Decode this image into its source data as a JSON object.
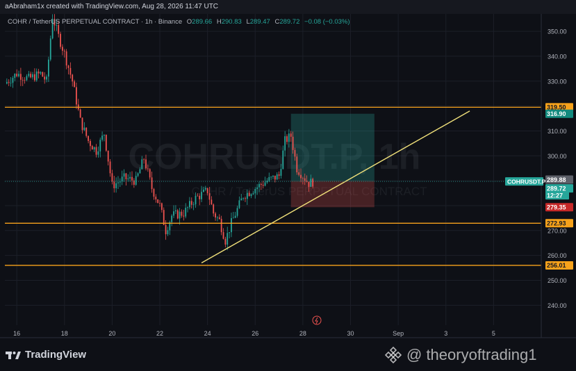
{
  "header": {
    "creator": "aAbraham1x created with TradingView.com, Aug 28, 2026 11:47 UTC",
    "symbol": "COHR / TetherUS PERPETUAL CONTRACT · 1h · Binance",
    "ohlc": [
      {
        "k": "O",
        "v": "289.66"
      },
      {
        "k": "H",
        "v": "290.83"
      },
      {
        "k": "L",
        "v": "289.47"
      },
      {
        "k": "C",
        "v": "289.72"
      }
    ],
    "change": "−0.08 (−0.03%)"
  },
  "watermark": {
    "big": "COHRUSDT.P, 1h",
    "small": "COHR / TetherUS PERPETUAL CONTRACT"
  },
  "footer": {
    "brand": "TradingView",
    "handle": "@ theoryoftrading1"
  },
  "colors": {
    "up": "#26a69a",
    "down": "#ef5350",
    "level": "#f7a21b",
    "trendline": "#f0e07a",
    "background": "#0e1016"
  },
  "chart_data": {
    "type": "candlestick",
    "title": "COHR / TetherUS PERPETUAL CONTRACT · 1h · Binance",
    "yaxis": {
      "ticks": [
        240,
        250,
        260,
        270,
        280,
        290,
        300,
        310,
        320,
        330,
        340,
        350
      ],
      "range": [
        232,
        357
      ]
    },
    "xaxis": {
      "range": [
        "Aug 15 12:00",
        "Sep 7 00:00"
      ],
      "ticks": [
        {
          "date": "Aug 16",
          "label": "16"
        },
        {
          "date": "Aug 18",
          "label": "18"
        },
        {
          "date": "Aug 20",
          "label": "20"
        },
        {
          "date": "Aug 22",
          "label": "22"
        },
        {
          "date": "Aug 24",
          "label": "24"
        },
        {
          "date": "Aug 26",
          "label": "26"
        },
        {
          "date": "Aug 28",
          "label": "28"
        },
        {
          "date": "Aug 30",
          "label": "30"
        },
        {
          "date": "Sep 1",
          "label": "Sep"
        },
        {
          "date": "Sep 3",
          "label": "3"
        },
        {
          "date": "Sep 5",
          "label": "5"
        }
      ]
    },
    "price_path": [
      {
        "t": "Aug 15 12:00",
        "p": 329
      },
      {
        "t": "Aug 16 00:00",
        "p": 333
      },
      {
        "t": "Aug 16 12:00",
        "p": 331
      },
      {
        "t": "Aug 17 00:00",
        "p": 333
      },
      {
        "t": "Aug 17 06:00",
        "p": 330
      },
      {
        "t": "Aug 17 12:00",
        "p": 356
      },
      {
        "t": "Aug 17 18:00",
        "p": 348
      },
      {
        "t": "Aug 18 00:00",
        "p": 341
      },
      {
        "t": "Aug 18 08:00",
        "p": 330
      },
      {
        "t": "Aug 18 16:00",
        "p": 314
      },
      {
        "t": "Aug 19 00:00",
        "p": 306
      },
      {
        "t": "Aug 19 08:00",
        "p": 302
      },
      {
        "t": "Aug 19 16:00",
        "p": 309
      },
      {
        "t": "Aug 20 00:00",
        "p": 288
      },
      {
        "t": "Aug 20 12:00",
        "p": 291
      },
      {
        "t": "Aug 21 00:00",
        "p": 290
      },
      {
        "t": "Aug 21 08:00",
        "p": 299
      },
      {
        "t": "Aug 21 16:00",
        "p": 287
      },
      {
        "t": "Aug 22 00:00",
        "p": 280
      },
      {
        "t": "Aug 22 06:00",
        "p": 270
      },
      {
        "t": "Aug 22 12:00",
        "p": 276
      },
      {
        "t": "Aug 23 00:00",
        "p": 277
      },
      {
        "t": "Aug 23 12:00",
        "p": 283
      },
      {
        "t": "Aug 24 00:00",
        "p": 286
      },
      {
        "t": "Aug 24 06:00",
        "p": 277
      },
      {
        "t": "Aug 24 12:00",
        "p": 274
      },
      {
        "t": "Aug 24 18:00",
        "p": 266
      },
      {
        "t": "Aug 25 00:00",
        "p": 273
      },
      {
        "t": "Aug 25 12:00",
        "p": 284
      },
      {
        "t": "Aug 26 00:00",
        "p": 287
      },
      {
        "t": "Aug 26 12:00",
        "p": 290
      },
      {
        "t": "Aug 27 00:00",
        "p": 292
      },
      {
        "t": "Aug 27 06:00",
        "p": 306
      },
      {
        "t": "Aug 27 12:00",
        "p": 308
      },
      {
        "t": "Aug 27 18:00",
        "p": 295
      },
      {
        "t": "Aug 28 00:00",
        "p": 292
      },
      {
        "t": "Aug 28 06:00",
        "p": 289
      },
      {
        "t": "Aug 28 11:00",
        "p": 289.72
      }
    ],
    "horizontal_levels": [
      {
        "name": "resistance",
        "price": 319.5,
        "label": "319.50"
      },
      {
        "name": "support-1",
        "price": 272.93,
        "label": "272.93"
      },
      {
        "name": "support-2",
        "price": 256.01,
        "label": "256.01"
      }
    ],
    "trendline": {
      "from": {
        "t": "Aug 23 18:00",
        "p": 257
      },
      "to": {
        "t": "Sep 4 00:00",
        "p": 318
      }
    },
    "position": {
      "start": "Aug 27 12:00",
      "end": "Aug 31 00:00",
      "target": 316.9,
      "entry": 289.88,
      "stop": 279.35
    },
    "price_labels": [
      {
        "label": "319.50",
        "kind": "level"
      },
      {
        "label": "316.90",
        "kind": "target"
      },
      {
        "label": "289.88",
        "kind": "entry"
      },
      {
        "label": "COHRUSDT.P",
        "kind": "symbol"
      },
      {
        "label": "289.72",
        "kind": "last"
      },
      {
        "label": "12:27",
        "kind": "countdown"
      },
      {
        "label": "279.35",
        "kind": "stop"
      },
      {
        "label": "272.93",
        "kind": "level"
      },
      {
        "label": "256.01",
        "kind": "level"
      }
    ]
  }
}
